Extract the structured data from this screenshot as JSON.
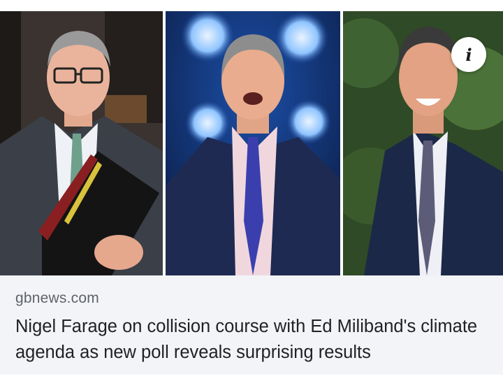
{
  "article": {
    "source": "gbnews.com",
    "headline": "Nigel Farage on collision course with Ed Miliband's climate agenda as new poll reveals surprising results"
  },
  "info_button": {
    "icon": "info-icon",
    "label": "i"
  },
  "photos": [
    {
      "subject": "man-in-suit-holding-red-folder"
    },
    {
      "subject": "man-speaking-stage-lights"
    },
    {
      "subject": "man-smiling-outdoors"
    }
  ],
  "colors": {
    "meta_background": "#f3f4f8",
    "source_text": "#5f6368",
    "headline_text": "#202124"
  }
}
